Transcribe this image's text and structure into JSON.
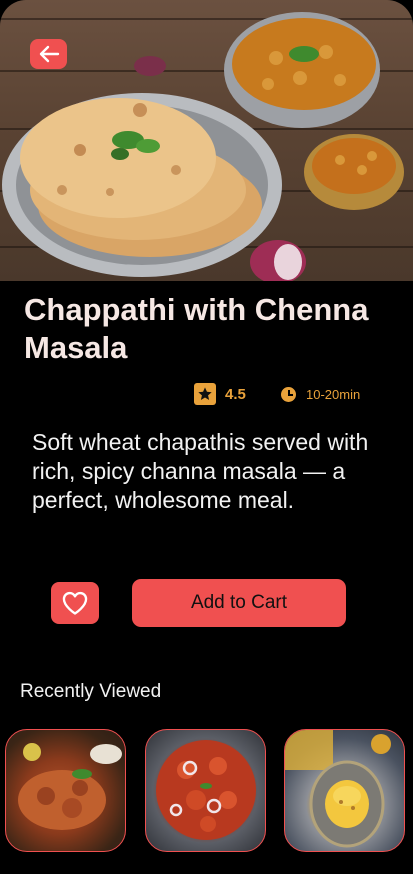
{
  "colors": {
    "accent": "#f05050",
    "rating": "#e9a23b",
    "background": "#000000"
  },
  "header": {
    "back_icon": "arrow-left-icon"
  },
  "dish": {
    "title": "Chappathi  with Chenna Masala",
    "rating": "4.5",
    "time": "10-20min",
    "description": "Soft wheat chapathis served with rich, spicy channa masala — a perfect, wholesome meal."
  },
  "actions": {
    "favorite_icon": "heart-icon",
    "add_to_cart_label": "Add to Cart"
  },
  "recent": {
    "title": "Recently Viewed",
    "items": [
      {
        "image": "chicken-curry-photo"
      },
      {
        "image": "chilli-chicken-photo"
      },
      {
        "image": "sweet-pongal-photo"
      }
    ]
  }
}
